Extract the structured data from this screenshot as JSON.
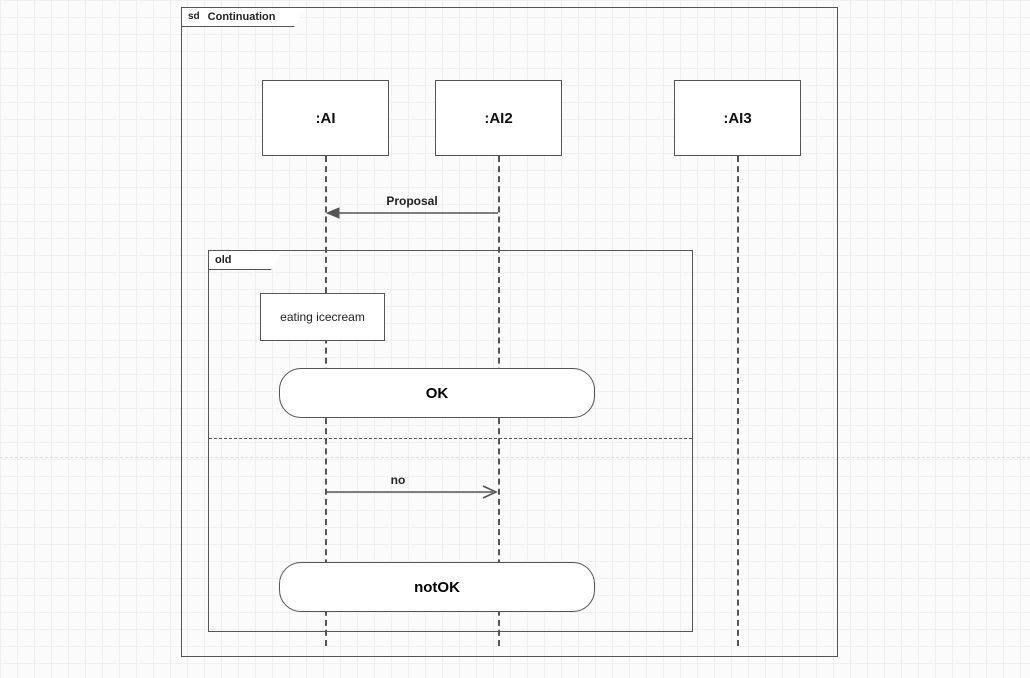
{
  "frame": {
    "kind": "sd",
    "title": "Continuation"
  },
  "lifelines": {
    "a": ":AI",
    "b": ":AI2",
    "c": ":AI3"
  },
  "messages": {
    "proposal": "Proposal",
    "no": "no"
  },
  "fragment": {
    "operator": "old"
  },
  "invariant": {
    "eating": "eating icecream"
  },
  "continuations": {
    "ok": "OK",
    "notok": "notOK"
  }
}
